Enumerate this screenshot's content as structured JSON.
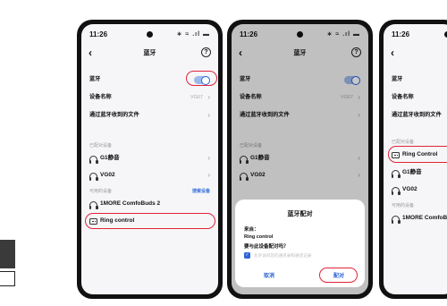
{
  "status": {
    "time": "11:26",
    "icons": "∗ ≈ .ıl ▬"
  },
  "nav": {
    "title": "蓝牙",
    "help": "?"
  },
  "settings": {
    "bluetooth_label": "蓝牙",
    "device_name_label": "设备名称",
    "device_name_value": "VG67",
    "received_files_label": "通过蓝牙收到的文件",
    "paired_section": "已配对设备",
    "available_section": "可用的设备",
    "refresh_label": "搜索设备"
  },
  "paired_devices": [
    "G1静音",
    "VG02"
  ],
  "available_devices": [
    "1MORE ComfoBuds 2",
    "Ring control"
  ],
  "screen3_paired_devices": [
    "Ring Control",
    "G1静音",
    "VG02"
  ],
  "screen3_available_devices": [
    "1MORE ComfoBuds 2"
  ],
  "dialog": {
    "title": "蓝牙配对",
    "from_label": "来自：",
    "from_device": "Ring control",
    "question": "要与此设备配对吗？",
    "checkbox_label": "允许访问您的通讯录和通话记录",
    "cancel": "取消",
    "confirm": "配对"
  },
  "colors": {
    "accent": "#2f64d6",
    "highlight": "#e0243a",
    "screen_bg": "#f6f6f8"
  }
}
